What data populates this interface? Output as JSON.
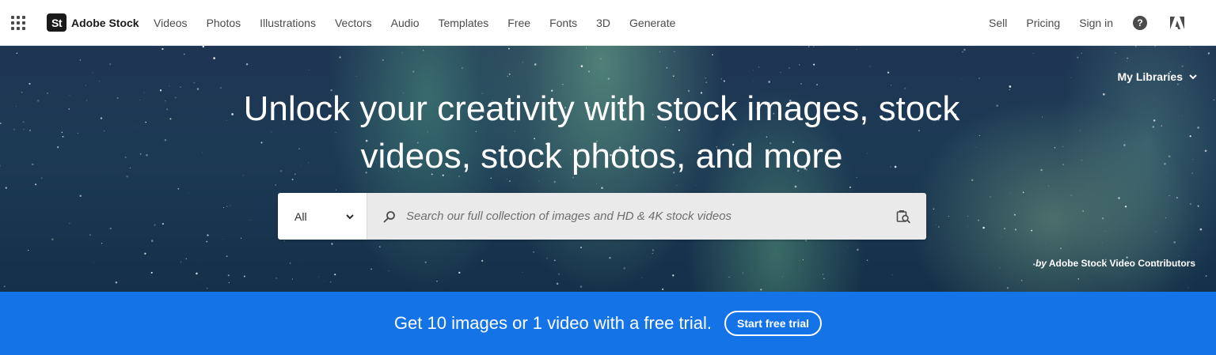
{
  "header": {
    "brand_badge": "St",
    "brand_name": "Adobe Stock",
    "nav": [
      "Videos",
      "Photos",
      "Illustrations",
      "Vectors",
      "Audio",
      "Templates",
      "Free",
      "Fonts",
      "3D",
      "Generate"
    ],
    "right": {
      "sell": "Sell",
      "pricing": "Pricing",
      "sign_in": "Sign in",
      "help_glyph": "?"
    }
  },
  "hero": {
    "my_libraries": "My Libraries",
    "title": "Unlock your creativity with stock images, stock videos, stock photos, and more",
    "search": {
      "filter_value": "All",
      "placeholder": "Search our full collection of images and HD & 4K stock videos"
    },
    "attribution_by": "by",
    "attribution_name": "Adobe Stock Video Contributors"
  },
  "promo": {
    "text": "Get 10 images or 1 video with a free trial.",
    "button": "Start free trial"
  },
  "colors": {
    "promo_bg": "#1473e6",
    "hero_sky": "#1d3a55",
    "search_field_bg": "#eaeaea"
  }
}
